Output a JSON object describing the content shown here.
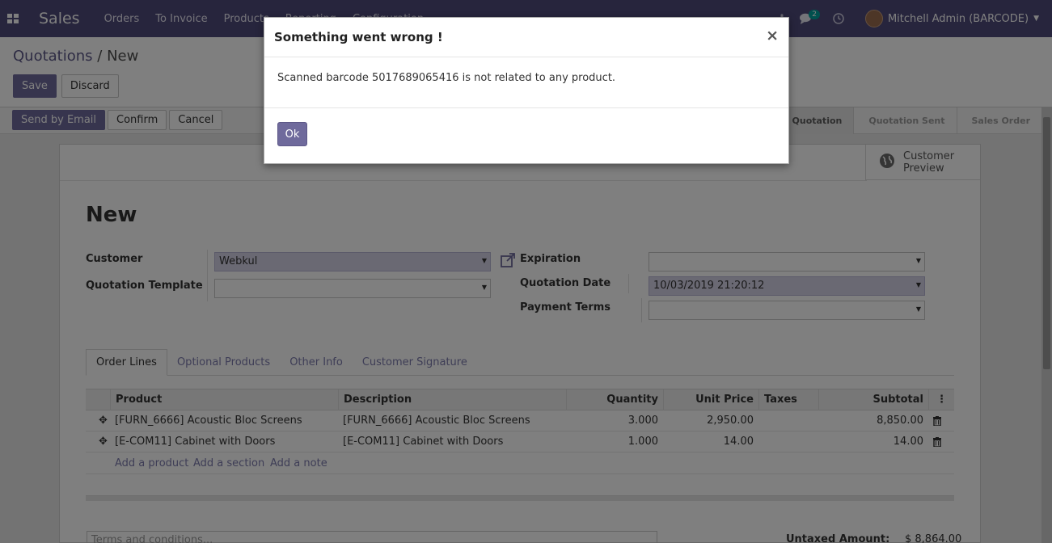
{
  "navbar": {
    "app_name": "Sales",
    "menu": [
      "Orders",
      "To Invoice",
      "Products",
      "Reporting",
      "Configuration"
    ],
    "messages_count": "2",
    "user_name": "Mitchell Admin (BARCODE)"
  },
  "breadcrumb": {
    "parent": "Quotations",
    "separator": " / ",
    "current": "New"
  },
  "toolbar": {
    "save_label": "Save",
    "discard_label": "Discard"
  },
  "statusbar": {
    "send_email": "Send by Email",
    "confirm": "Confirm",
    "cancel": "Cancel",
    "stages": [
      "Quotation",
      "Quotation Sent",
      "Sales Order"
    ]
  },
  "sheet": {
    "customer_preview": "Customer Preview",
    "title": "New",
    "customer_label": "Customer",
    "customer_value": "Webkul",
    "template_label": "Quotation Template",
    "template_value": "",
    "expiration_label": "Expiration",
    "expiration_value": "",
    "quotation_date_label": "Quotation Date",
    "quotation_date_value": "10/03/2019 21:20:12",
    "payment_terms_label": "Payment Terms",
    "payment_terms_value": ""
  },
  "tabs": [
    "Order Lines",
    "Optional Products",
    "Other Info",
    "Customer Signature"
  ],
  "table": {
    "headers": [
      "Product",
      "Description",
      "Quantity",
      "Unit Price",
      "Taxes",
      "Subtotal"
    ],
    "rows": [
      {
        "product": "[FURN_6666] Acoustic Bloc Screens",
        "description": "[FURN_6666] Acoustic Bloc Screens",
        "quantity": "3.000",
        "unit_price": "2,950.00",
        "taxes": "",
        "subtotal": "8,850.00"
      },
      {
        "product": "[E-COM11] Cabinet with Doors",
        "description": "[E-COM11] Cabinet with Doors",
        "quantity": "1.000",
        "unit_price": "14.00",
        "taxes": "",
        "subtotal": "14.00"
      }
    ],
    "add_product": "Add a product",
    "add_section": "Add a section",
    "add_note": "Add a note"
  },
  "footer": {
    "terms_placeholder": "Terms and conditions...",
    "untaxed_label": "Untaxed Amount:",
    "untaxed_value": "$ 8,864.00"
  },
  "modal": {
    "title": "Something went wrong !",
    "close": "×",
    "message": "Scanned barcode 5017689065416 is not related to any product.",
    "ok_label": "Ok"
  },
  "colors": {
    "navbar": "#4e4a7a",
    "primary": "#6f6a9c",
    "link": "#7c7bad",
    "badge": "#00a09d"
  }
}
